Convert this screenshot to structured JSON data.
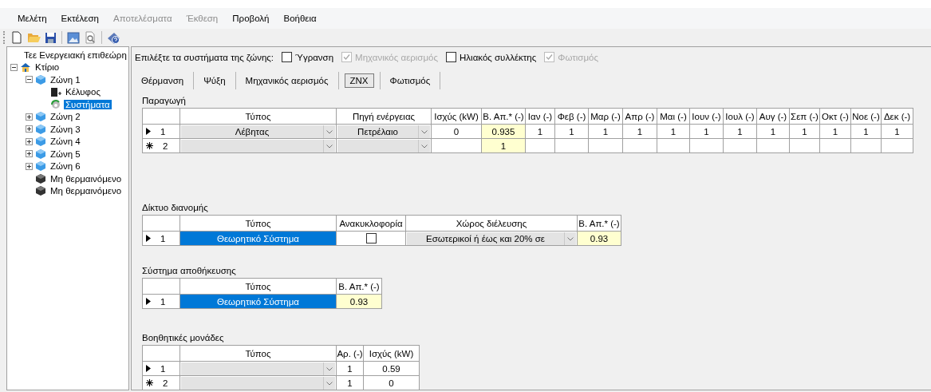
{
  "menu": [
    {
      "label": "Μελέτη",
      "disabled": false
    },
    {
      "label": "Εκτέλεση",
      "disabled": false
    },
    {
      "label": "Αποτελέσματα",
      "disabled": true
    },
    {
      "label": "Έκθεση",
      "disabled": true
    },
    {
      "label": "Προβολή",
      "disabled": false
    },
    {
      "label": "Βοήθεια",
      "disabled": false
    }
  ],
  "tree": [
    {
      "label": "Τεε Ενεργειακή επιθεώρη",
      "kind": "project",
      "selected": false
    },
    {
      "label": "Κτίριο",
      "kind": "building",
      "selected": false,
      "expanded": true,
      "children": [
        {
          "label": "Ζώνη 1",
          "kind": "zone",
          "selected": false,
          "expanded": true,
          "children": [
            {
              "label": "Κέλυφος",
              "kind": "shell",
              "selected": false
            },
            {
              "label": "Συστήματα",
              "kind": "systems",
              "selected": true
            }
          ]
        },
        {
          "label": "Ζώνη 2",
          "kind": "zone",
          "selected": false,
          "expanded": false
        },
        {
          "label": "Ζώνη 3",
          "kind": "zone",
          "selected": false,
          "expanded": false
        },
        {
          "label": "Ζώνη 4",
          "kind": "zone",
          "selected": false,
          "expanded": false
        },
        {
          "label": "Ζώνη 5",
          "kind": "zone",
          "selected": false,
          "expanded": false
        },
        {
          "label": "Ζώνη 6",
          "kind": "zone",
          "selected": false,
          "expanded": false
        },
        {
          "label": "Μη θερμαινόμενο",
          "kind": "unheated",
          "selected": false
        },
        {
          "label": "Μη θερμαινόμενο",
          "kind": "unheated",
          "selected": false
        }
      ]
    }
  ],
  "zone_systems": {
    "label": "Επιλέξτε τα συστήματα της ζώνης:",
    "options": [
      {
        "label": "Ύγρανση",
        "checked": false,
        "disabled": false
      },
      {
        "label": "Μηχανικός αερισμός",
        "checked": true,
        "disabled": true
      },
      {
        "label": "Ηλιακός συλλέκτης",
        "checked": false,
        "disabled": false
      },
      {
        "label": "Φωτισμός",
        "checked": true,
        "disabled": true
      }
    ]
  },
  "tabs": [
    {
      "label": "Θέρμανση",
      "selected": false
    },
    {
      "label": "Ψύξη",
      "selected": false
    },
    {
      "label": "Μηχανικός αερισμός",
      "selected": false
    },
    {
      "label": "ZNX",
      "selected": true
    },
    {
      "label": "Φωτισμός",
      "selected": false
    }
  ],
  "sections": [
    {
      "title": "Παραγωγή",
      "columns": [
        "Τύπος",
        "Πηγή ενέργειας",
        "Ισχύς (kW)",
        "Β. Απ.* (-)",
        "Ιαν (-)",
        "Φεβ (-)",
        "Μαρ (-)",
        "Απρ (-)",
        "Μαι (-)",
        "Ιουν (-)",
        "Ιουλ (-)",
        "Αυγ (-)",
        "Σεπ (-)",
        "Οκτ (-)",
        "Νοε (-)",
        "Δεκ (-)"
      ],
      "rows": [
        {
          "kind": "current",
          "number": "1",
          "cells": [
            {
              "kind": "combo",
              "value": "Λέβητας"
            },
            {
              "kind": "combo",
              "value": "Πετρέλαιο"
            },
            {
              "kind": "text",
              "value": "0"
            },
            {
              "kind": "accent",
              "value": "0.935"
            },
            {
              "kind": "text",
              "value": "1"
            },
            {
              "kind": "text",
              "value": "1"
            },
            {
              "kind": "text",
              "value": "1"
            },
            {
              "kind": "text",
              "value": "1"
            },
            {
              "kind": "text",
              "value": "1"
            },
            {
              "kind": "text",
              "value": "1"
            },
            {
              "kind": "text",
              "value": "1"
            },
            {
              "kind": "text",
              "value": "1"
            },
            {
              "kind": "text",
              "value": "1"
            },
            {
              "kind": "text",
              "value": "1"
            },
            {
              "kind": "text",
              "value": "1"
            },
            {
              "kind": "text",
              "value": "1"
            }
          ]
        },
        {
          "kind": "new",
          "number": "2",
          "cells": [
            {
              "kind": "combo"
            },
            {
              "kind": "combo"
            },
            {
              "kind": "text"
            },
            {
              "kind": "accent",
              "value": "1"
            },
            {
              "kind": "text"
            },
            {
              "kind": "text"
            },
            {
              "kind": "text"
            },
            {
              "kind": "text"
            },
            {
              "kind": "text"
            },
            {
              "kind": "text"
            },
            {
              "kind": "text"
            },
            {
              "kind": "text"
            },
            {
              "kind": "text"
            },
            {
              "kind": "text"
            },
            {
              "kind": "text"
            },
            {
              "kind": "text"
            }
          ]
        }
      ]
    },
    {
      "title": "Δίκτυο διανομής",
      "columns": [
        "Τύπος",
        "Ανακυκλοφορία",
        "Χώρος διέλευσης",
        "Β. Απ.* (-)"
      ],
      "rows": [
        {
          "kind": "current",
          "number": "1",
          "cells": [
            {
              "kind": "selected",
              "value": "Θεωρητικό Σύστημα"
            },
            {
              "kind": "checkbox",
              "checked": false
            },
            {
              "kind": "combo",
              "value": "Εσωτερικοί  ή έως και 20% σε"
            },
            {
              "kind": "accent",
              "value": "0.93"
            }
          ]
        }
      ]
    },
    {
      "title": "Σύστημα αποθήκευσης",
      "columns": [
        "Τύπος",
        "Β. Απ.* (-)"
      ],
      "rows": [
        {
          "kind": "current",
          "number": "1",
          "cells": [
            {
              "kind": "selected",
              "value": "Θεωρητικό Σύστημα"
            },
            {
              "kind": "accent",
              "value": "0.93"
            }
          ]
        }
      ]
    },
    {
      "title": "Βοηθητικές μονάδες",
      "columns": [
        "Τύπος",
        "Αρ. (-)",
        "Ισχύς (kW)"
      ],
      "rows": [
        {
          "kind": "current",
          "number": "1",
          "cells": [
            {
              "kind": "combo"
            },
            {
              "kind": "text",
              "value": "1"
            },
            {
              "kind": "text",
              "value": "0.59"
            }
          ]
        },
        {
          "kind": "new",
          "number": "2",
          "cells": [
            {
              "kind": "combo"
            },
            {
              "kind": "text",
              "value": "1"
            },
            {
              "kind": "text",
              "value": "0"
            }
          ]
        }
      ]
    }
  ]
}
